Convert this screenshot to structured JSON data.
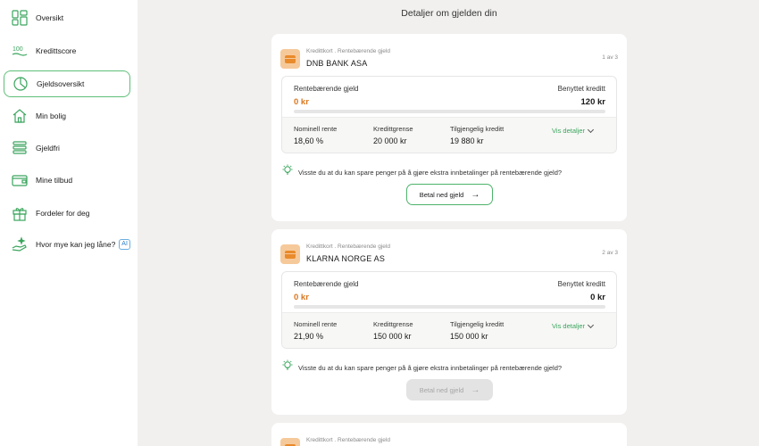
{
  "sidebar": {
    "items": [
      {
        "label": "Oversikt",
        "icon": "grid-icon",
        "active": false
      },
      {
        "label": "Kredittscore",
        "icon": "score-icon",
        "active": false
      },
      {
        "label": "Gjeldsoversikt",
        "icon": "pie-chart-icon",
        "active": true
      },
      {
        "label": "Min bolig",
        "icon": "house-icon",
        "active": false
      },
      {
        "label": "Gjeldfri",
        "icon": "stack-icon",
        "active": false
      },
      {
        "label": "Mine tilbud",
        "icon": "wallet-icon",
        "active": false
      },
      {
        "label": "Fordeler for deg",
        "icon": "gift-icon",
        "active": false
      },
      {
        "label": "Hvor mye kan jeg låne?",
        "icon": "hand-sparkle-icon",
        "badge": "AI",
        "active": false
      }
    ]
  },
  "main": {
    "title": "Detaljer om gjelden din",
    "cards": [
      {
        "subtitle": "Kredittkort . Rentebærende gjeld",
        "name": "DNB BANK ASA",
        "count": "1 av 3",
        "left_label": "Rentebærende gjeld",
        "left_value": "0 kr",
        "right_label": "Benyttet kreditt",
        "right_value": "120 kr",
        "progress": 0,
        "details": [
          {
            "label": "Nominell rente",
            "value": "18,60 %"
          },
          {
            "label": "Kredittgrense",
            "value": "20 000 kr"
          },
          {
            "label": "Tilgjengelig kreditt",
            "value": "19 880 kr"
          }
        ],
        "details_link": "Vis detaljer",
        "tip": "Visste du at du kan spare penger på å gjøre ekstra innbetalinger på rentebærende gjeld?",
        "button": "Betal ned gjeld",
        "button_enabled": true
      },
      {
        "subtitle": "Kredittkort . Rentebærende gjeld",
        "name": "KLARNA NORGE AS",
        "count": "2 av 3",
        "left_label": "Rentebærende gjeld",
        "left_value": "0 kr",
        "right_label": "Benyttet kreditt",
        "right_value": "0 kr",
        "progress": 0,
        "details": [
          {
            "label": "Nominell rente",
            "value": "21,90 %"
          },
          {
            "label": "Kredittgrense",
            "value": "150 000 kr"
          },
          {
            "label": "Tilgjengelig kreditt",
            "value": "150 000 kr"
          }
        ],
        "details_link": "Vis detaljer",
        "tip": "Visste du at du kan spare penger på å gjøre ekstra innbetalinger på rentebærende gjeld?",
        "button": "Betal ned gjeld",
        "button_enabled": false
      },
      {
        "subtitle": "Kredittkort . Rentebærende gjeld"
      }
    ]
  },
  "colors": {
    "accent_green": "#4cb36a",
    "debt_orange": "#d9771f",
    "card_icon_bg": "#f6c99a",
    "page_bg": "#f1f0ee"
  }
}
